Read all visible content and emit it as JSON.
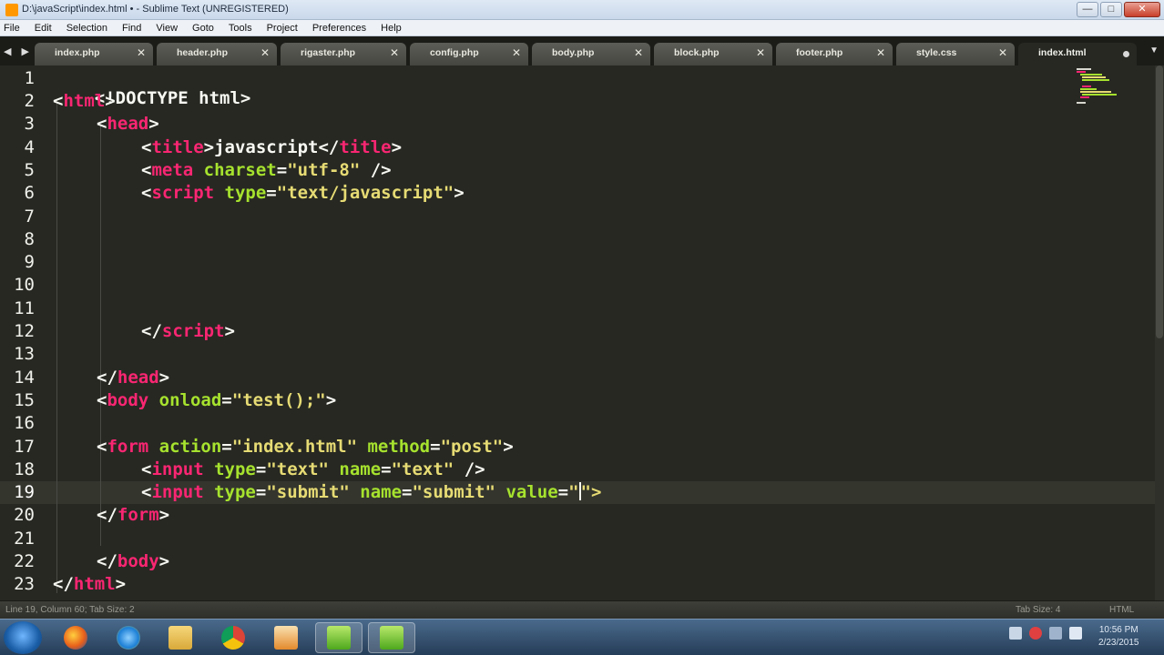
{
  "window": {
    "title": "D:\\javaScript\\index.html • - Sublime Text (UNREGISTERED)",
    "min_label": "—",
    "max_label": "□",
    "close_label": "✕"
  },
  "menu": [
    "File",
    "Edit",
    "Selection",
    "Find",
    "View",
    "Goto",
    "Tools",
    "Project",
    "Preferences",
    "Help"
  ],
  "tabbar": {
    "nav_label": "◀ ▶",
    "menu_label": "▼",
    "tabs": [
      {
        "label": "index.php",
        "close": "✕"
      },
      {
        "label": "header.php",
        "close": "✕"
      },
      {
        "label": "rigaster.php",
        "close": "✕"
      },
      {
        "label": "config.php",
        "close": "✕"
      },
      {
        "label": "body.php",
        "close": "✕"
      },
      {
        "label": "block.php",
        "close": "✕"
      },
      {
        "label": "footer.php",
        "close": "✕"
      },
      {
        "label": "style.css",
        "close": "✕"
      },
      {
        "label": "index.html",
        "close": ""
      }
    ]
  },
  "editor": {
    "line_numbers": [
      "1",
      "2",
      "3",
      "4",
      "5",
      "6",
      "7",
      "8",
      "9",
      "10",
      "11",
      "12",
      "13",
      "14",
      "15",
      "16",
      "17",
      "18",
      "19",
      "20",
      "21",
      "22",
      "23"
    ],
    "active_line": 19,
    "code": {
      "l1": "<!DOCTYPE html>",
      "l2": [
        "<",
        "html",
        ">"
      ],
      "l3": [
        "<",
        "head",
        ">"
      ],
      "l4": [
        "<",
        "title",
        ">javascript</",
        "title",
        ">"
      ],
      "l5": [
        "<",
        "meta",
        " charset",
        "=",
        "\"utf-8\"",
        " />"
      ],
      "l6": [
        "<",
        "script",
        " type",
        "=",
        "\"text/javascript\"",
        ">"
      ],
      "l12": [
        "</",
        "script",
        ">"
      ],
      "l14": [
        "</",
        "head",
        ">"
      ],
      "l15": [
        "<",
        "body",
        " onload",
        "=",
        "\"test();\"",
        ">"
      ],
      "l17": [
        "<",
        "form",
        " action",
        "=",
        "\"index.html\"",
        " method",
        "=",
        "\"post\"",
        ">"
      ],
      "l18": [
        "<",
        "input",
        " type",
        "=",
        "\"text\"",
        " name",
        "=",
        "\"text\"",
        " />"
      ],
      "l19": [
        "<",
        "input",
        " type",
        "=",
        "\"submit\"",
        " name",
        "=",
        "\"submit\"",
        " value",
        "=",
        "\"",
        "\">"
      ],
      "l20": [
        "</",
        "form",
        ">"
      ],
      "l22": [
        "</",
        "body",
        ">"
      ],
      "l23": [
        "</",
        "html",
        ">"
      ]
    }
  },
  "status": {
    "left": "Line 19, Column 60; Tab Size: 2",
    "tab_size": "Tab Size: 4",
    "syntax": "HTML"
  },
  "taskbar": {
    "clock_time": "10:56 PM",
    "clock_date": "2/23/2015"
  },
  "colors": {
    "background": "#272822",
    "tag": "#f92672",
    "attribute": "#a6e22e",
    "string": "#e6db74",
    "text": "#f8f8f2"
  }
}
